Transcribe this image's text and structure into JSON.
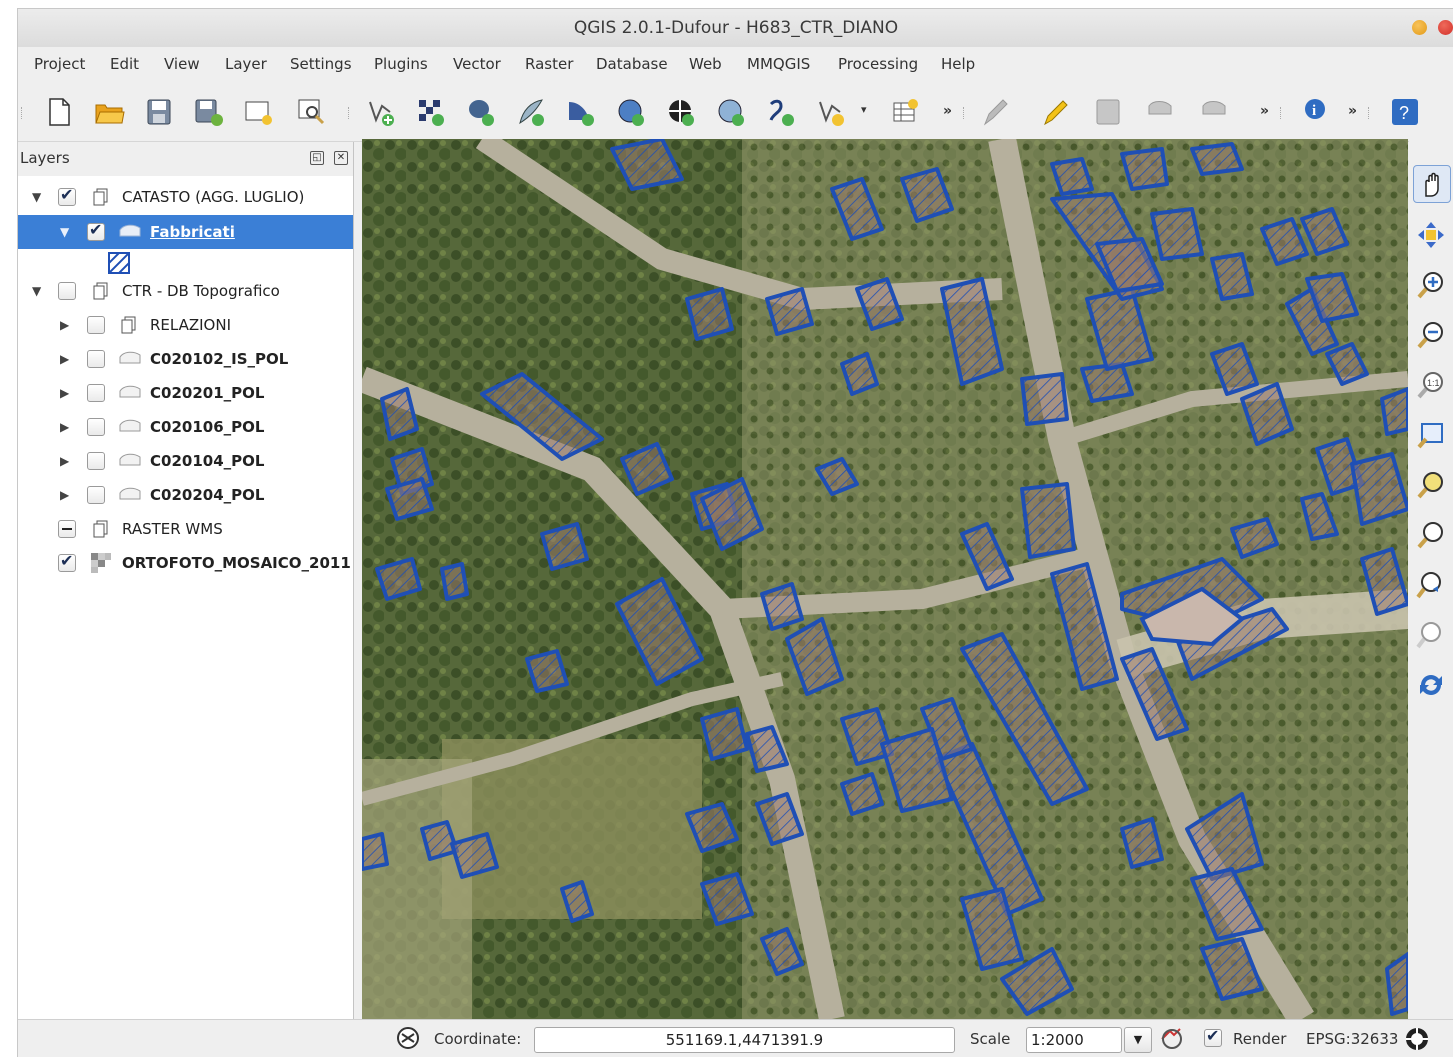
{
  "window": {
    "title": "QGIS 2.0.1-Dufour - H683_CTR_DIANO"
  },
  "menu": [
    "Project",
    "Edit",
    "View",
    "Layer",
    "Settings",
    "Plugins",
    "Vector",
    "Raster",
    "Database",
    "Web",
    "MMQGIS",
    "Processing",
    "Help"
  ],
  "toolbar": {
    "more": "»",
    "dropdown": "▾"
  },
  "layers_panel": {
    "title": "Layers",
    "items": [
      {
        "name": "CATASTO (AGG. LUGLIO)",
        "checked": true,
        "type": "group",
        "expanded": true
      },
      {
        "name": "Fabbricati",
        "checked": true,
        "type": "polygon",
        "selected": true
      },
      {
        "name": "CTR - DB Topografico",
        "checked": false,
        "type": "group",
        "expanded": true
      },
      {
        "name": "RELAZIONI",
        "checked": false,
        "type": "group"
      },
      {
        "name": "C020102_IS_POL",
        "checked": false,
        "type": "polygon"
      },
      {
        "name": "C020201_POL",
        "checked": false,
        "type": "polygon"
      },
      {
        "name": "C020106_POL",
        "checked": false,
        "type": "polygon"
      },
      {
        "name": "C020104_POL",
        "checked": false,
        "type": "polygon"
      },
      {
        "name": "C020204_POL",
        "checked": false,
        "type": "polygon"
      },
      {
        "name": "RASTER WMS",
        "checked": "partial",
        "type": "group"
      },
      {
        "name": "ORTOFOTO_MOSAICO_2011",
        "checked": true,
        "type": "raster"
      }
    ]
  },
  "status": {
    "coord_label": "Coordinate:",
    "coordinate": "551169.1,4471391.9",
    "scale_label": "Scale",
    "scale": "1:2000",
    "render_label": "Render",
    "render_checked": true,
    "crs": "EPSG:32633"
  },
  "colors": {
    "selection": "#3b7fd6",
    "building_outline": "#1f4fb5",
    "road": "#b6b09d"
  }
}
